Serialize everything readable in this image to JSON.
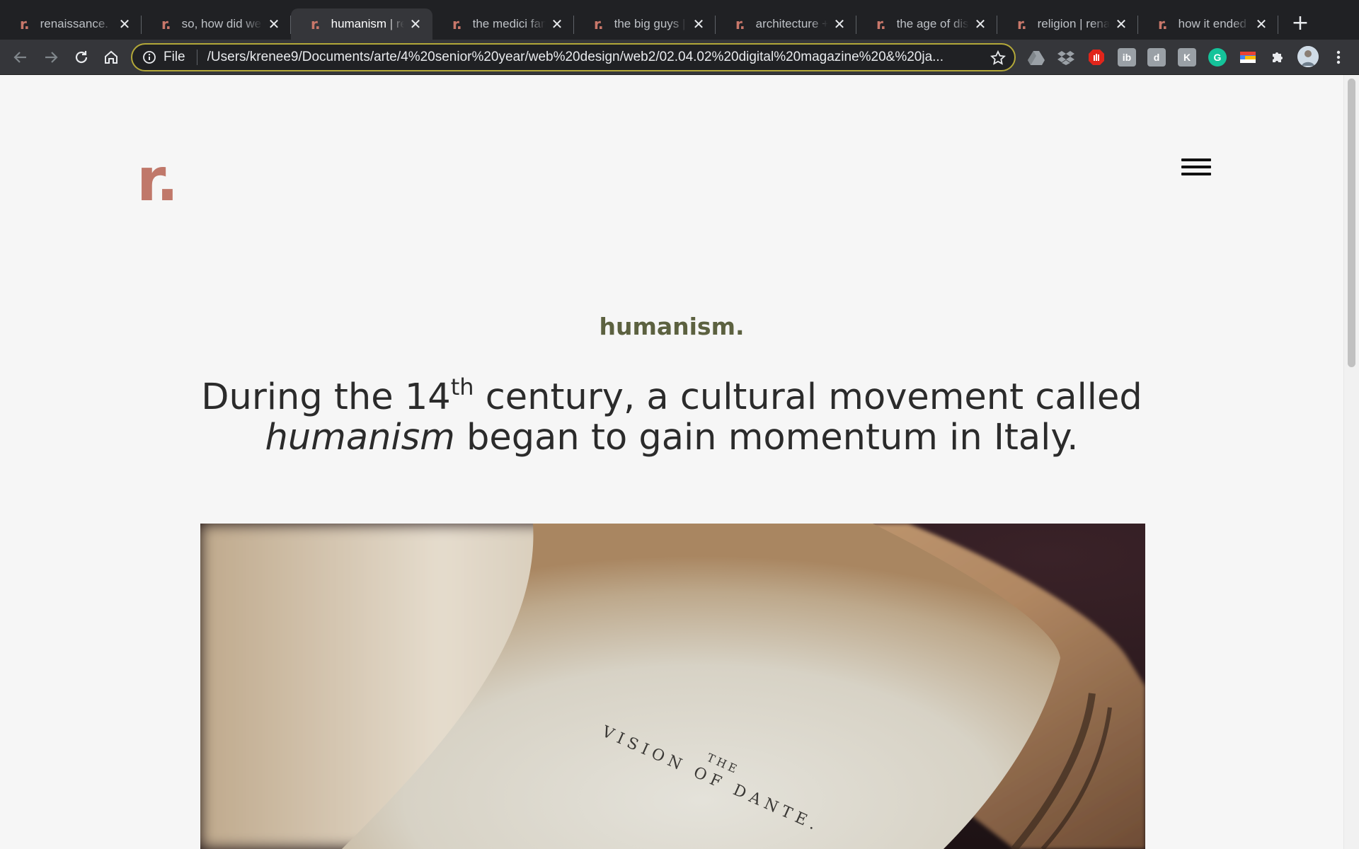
{
  "browser": {
    "tabs": [
      {
        "favicon": "r.",
        "title": "renaissance."
      },
      {
        "favicon": "r.",
        "title": "so, how did we"
      },
      {
        "favicon": "r.",
        "title": "humanism | ren"
      },
      {
        "favicon": "r.",
        "title": "the medici fam"
      },
      {
        "favicon": "r.",
        "title": "the big guys | r"
      },
      {
        "favicon": "r.",
        "title": "architecture + s"
      },
      {
        "favicon": "r.",
        "title": "the age of disc"
      },
      {
        "favicon": "r.",
        "title": "religion | renais"
      },
      {
        "favicon": "r.",
        "title": "how it ended +"
      }
    ],
    "active_tab": 2,
    "omnibox": {
      "scheme": "File",
      "url": "/Users/krenee9/Documents/arte/4%20senior%20year/web%20design/web2/02.04.02%20digital%20magazine%20&%20ja..."
    },
    "extensions": [
      "google-drive-icon",
      "dropbox-icon",
      "adblock-icon",
      "ib-icon",
      "d-icon",
      "k-icon",
      "grammarly-icon",
      "color-picker-icon",
      "puzzle-icon"
    ],
    "colors": {
      "accent_outline": "#b3a839",
      "tab_bg": "#202124",
      "toolbar_bg": "#35363a"
    }
  },
  "page": {
    "logo": "r.",
    "kicker": "humanism.",
    "lead": {
      "part1": "During the 14",
      "sup": "th",
      "part2": " century, a cultural movement called",
      "emphasis": "humanism",
      "part3": " began to gain momentum in Italy."
    },
    "image_caption_text": "THE VISION OF DANTE.",
    "colors": {
      "logo": "#c0786a",
      "kicker": "#5c6140",
      "text": "#2b2b2b",
      "background": "#f6f6f6"
    }
  }
}
